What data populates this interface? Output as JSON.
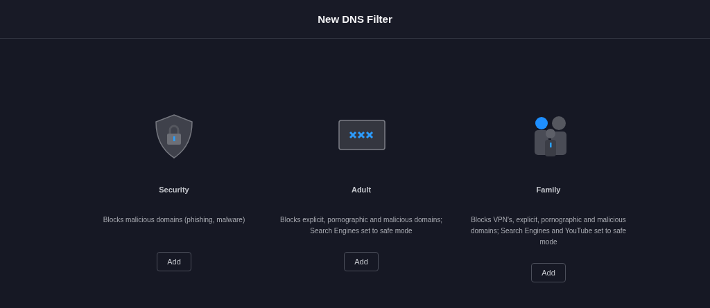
{
  "title": "New DNS Filter",
  "filters": [
    {
      "kind": "shield",
      "name": "Security",
      "description": "Blocks malicious domains (phishing, malware)",
      "button": "Add"
    },
    {
      "kind": "screen",
      "name": "Adult",
      "description": "Blocks explicit, pornographic and malicious domains; Search Engines set to safe mode",
      "button": "Add"
    },
    {
      "kind": "family",
      "name": "Family",
      "description": "Blocks VPN's, explicit, pornographic and malicious domains; Search Engines and YouTube set to safe mode",
      "button": "Add"
    }
  ]
}
